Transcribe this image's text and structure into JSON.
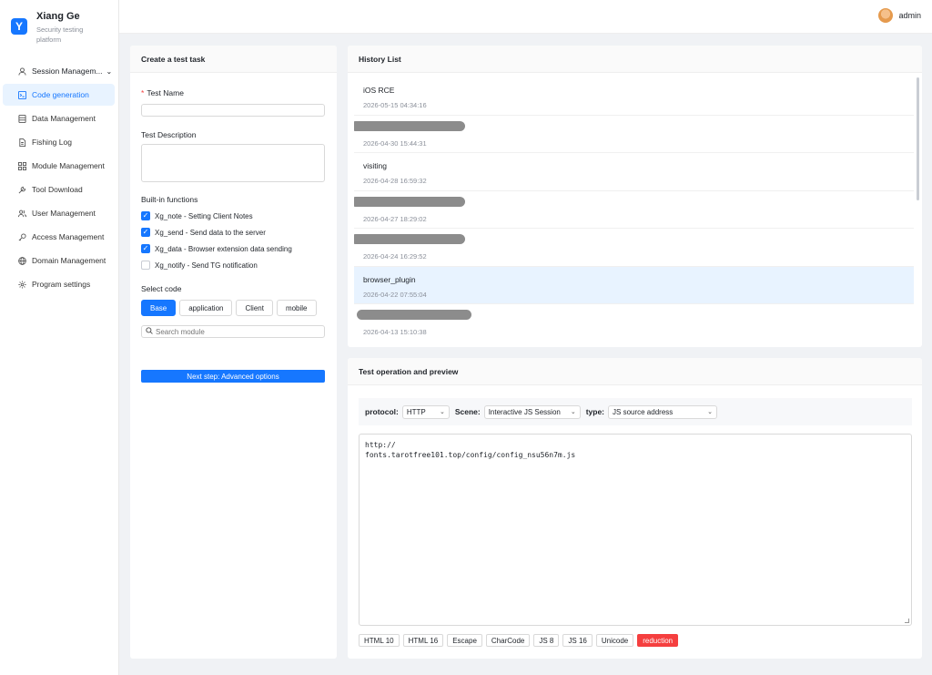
{
  "brand": {
    "name": "Xiang Ge",
    "subtitle": "Security testing platform",
    "logo_letter": "Y",
    "accent": "#1677ff"
  },
  "header": {
    "user_name": "admin"
  },
  "sidebar": {
    "items": [
      {
        "label": "Session Managem...",
        "icon": "user-icon",
        "has_chevron": true
      },
      {
        "label": "Code generation",
        "icon": "code-icon",
        "active": true
      },
      {
        "label": "Data Management",
        "icon": "database-icon"
      },
      {
        "label": "Fishing Log",
        "icon": "document-icon"
      },
      {
        "label": "Module Management",
        "icon": "grid-icon"
      },
      {
        "label": "Tool Download",
        "icon": "wrench-icon"
      },
      {
        "label": "User Management",
        "icon": "users-icon"
      },
      {
        "label": "Access Management",
        "icon": "key-icon"
      },
      {
        "label": "Domain Management",
        "icon": "globe-icon"
      },
      {
        "label": "Program settings",
        "icon": "gear-icon"
      }
    ]
  },
  "create": {
    "title": "Create a test task",
    "test_name_label": "Test Name",
    "test_name_value": "",
    "test_desc_label": "Test Description",
    "builtin_label": "Built-in functions",
    "functions": [
      {
        "label": "Xg_note - Setting Client Notes",
        "checked": true
      },
      {
        "label": "Xg_send - Send data to the server",
        "checked": true
      },
      {
        "label": "Xg_data - Browser extension data sending",
        "checked": true
      },
      {
        "label": "Xg_notify - Send TG notification",
        "checked": false
      }
    ],
    "select_code_label": "Select code",
    "code_tabs": [
      "Base",
      "application",
      "Client",
      "mobile"
    ],
    "search_placeholder": "Search module",
    "next_button": "Next step: Advanced options"
  },
  "history": {
    "title": "History List",
    "items": [
      {
        "name": "iOS RCE",
        "time": "2026-05-15 04:34:16"
      },
      {
        "name": "",
        "time": "2026-04-30 15:44:31",
        "redacted": true
      },
      {
        "name": "visiting",
        "time": "2026-04-28 16:59:32"
      },
      {
        "name": "",
        "time": "2026-04-27 18:29:02",
        "redacted": true
      },
      {
        "name": "",
        "time": "2026-04-24 16:29:52",
        "redacted": true
      },
      {
        "name": "browser_plugin",
        "time": "2026-04-22 07:55:04",
        "selected": true
      },
      {
        "name": "",
        "time": "2026-04-13 15:10:38",
        "redacted": true
      }
    ]
  },
  "preview": {
    "title": "Test operation and preview",
    "protocol_label": "protocol:",
    "protocol_value": "HTTP",
    "scene_label": "Scene:",
    "scene_value": "Interactive JS Session",
    "type_label": "type:",
    "type_value": "JS source address",
    "code": "http://\nfonts.tarotfree101.top/config/config_nsu56n7m.js",
    "tools": [
      "HTML 10",
      "HTML 16",
      "Escape",
      "CharCode",
      "JS 8",
      "JS 16",
      "Unicode"
    ],
    "reduction_label": "reduction",
    "danger_color": "#f53f3f"
  }
}
